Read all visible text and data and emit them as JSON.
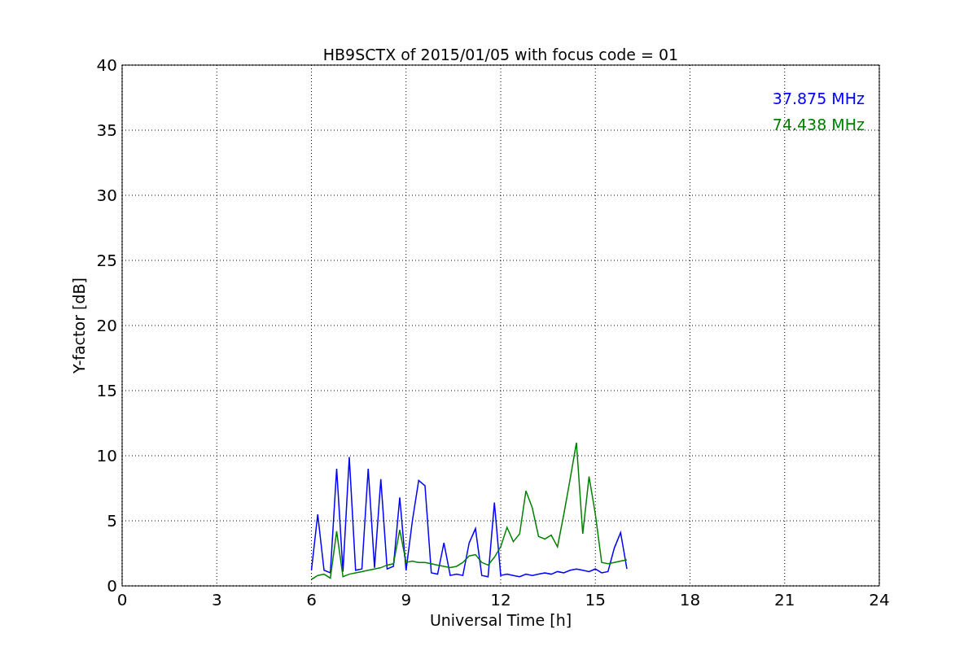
{
  "chart_data": {
    "type": "line",
    "grid": true,
    "title": "HB9SCTX of 2015/01/05 with focus code = 01",
    "xlabel": "Universal Time [h]",
    "ylabel": "Y-factor [dB]",
    "xlim": [
      0,
      24
    ],
    "ylim": [
      0,
      40
    ],
    "xticks": [
      0,
      3,
      6,
      9,
      12,
      15,
      18,
      21,
      24
    ],
    "yticks": [
      0,
      5,
      10,
      15,
      20,
      25,
      30,
      35,
      40
    ],
    "x": [
      6.0,
      6.2,
      6.4,
      6.6,
      6.8,
      7.0,
      7.2,
      7.4,
      7.6,
      7.8,
      8.0,
      8.2,
      8.4,
      8.6,
      8.8,
      9.0,
      9.2,
      9.4,
      9.6,
      9.8,
      10.0,
      10.2,
      10.4,
      10.6,
      10.8,
      11.0,
      11.2,
      11.4,
      11.6,
      11.8,
      12.0,
      12.2,
      12.4,
      12.6,
      12.8,
      13.0,
      13.2,
      13.4,
      13.6,
      13.8,
      14.0,
      14.2,
      14.4,
      14.6,
      14.8,
      15.0,
      15.2,
      15.4,
      15.6,
      15.8,
      16.0
    ],
    "series": [
      {
        "name": "37.875 MHz",
        "color": "#0000ff",
        "values": [
          1.2,
          5.5,
          1.2,
          1.0,
          9.0,
          1.1,
          9.9,
          1.2,
          1.3,
          9.0,
          1.4,
          8.2,
          1.3,
          1.5,
          6.8,
          1.2,
          5.0,
          8.1,
          7.7,
          1.0,
          0.9,
          3.3,
          0.8,
          0.9,
          0.8,
          3.3,
          4.4,
          0.8,
          0.7,
          6.4,
          0.8,
          0.9,
          0.8,
          0.7,
          0.9,
          0.8,
          0.9,
          1.0,
          0.9,
          1.1,
          1.0,
          1.2,
          1.3,
          1.2,
          1.1,
          1.3,
          1.0,
          1.1,
          2.9,
          4.1,
          1.3
        ]
      },
      {
        "name": "74.438 MHz",
        "color": "#008000",
        "values": [
          0.5,
          0.8,
          0.9,
          0.6,
          4.2,
          0.7,
          0.9,
          1.0,
          1.1,
          1.2,
          1.3,
          1.4,
          1.6,
          1.7,
          4.3,
          1.8,
          1.9,
          1.8,
          1.8,
          1.7,
          1.6,
          1.5,
          1.4,
          1.5,
          1.8,
          2.3,
          2.4,
          1.8,
          1.6,
          2.2,
          3.0,
          4.5,
          3.4,
          4.0,
          7.3,
          6.0,
          3.8,
          3.6,
          3.9,
          3.0,
          5.5,
          8.2,
          11.0,
          4.0,
          8.4,
          5.5,
          1.8,
          1.7,
          1.8,
          1.9,
          2.0
        ]
      }
    ]
  }
}
